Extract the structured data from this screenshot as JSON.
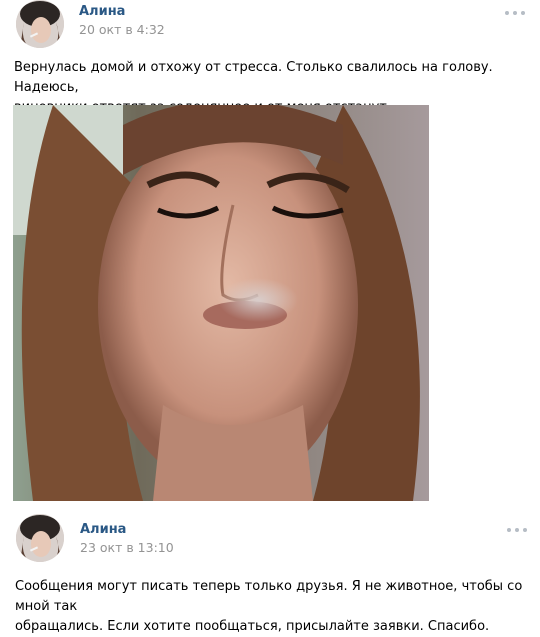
{
  "posts": [
    {
      "author": "Алина",
      "date": "20 окт в 4:32",
      "text_lines": [
        "Вернулась домой и отхожу от стресса. Столько свалилось на голову. Надеюсь,",
        "виновники ответят за соденянное и от меня отстанут."
      ],
      "has_photo": true
    },
    {
      "author": "Алина",
      "date": "23 окт в 13:10",
      "text_lines": [
        "Сообщения могут писать теперь только друзья. Я не животное, чтобы со мной так",
        "обращались. Если хотите пообщаться, присылайте заявки. Спасибо."
      ],
      "has_photo": false
    }
  ],
  "icons": {
    "more": "more-dots-icon"
  }
}
